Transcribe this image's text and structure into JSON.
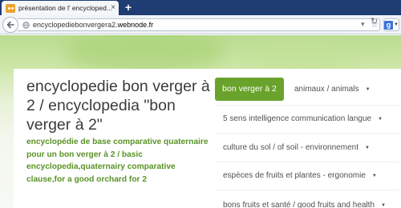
{
  "browser": {
    "tab_title": "présentation de l' encycloped...",
    "tab_close": "×",
    "new_tab": "+",
    "url_prefix": "encyclopediebonvergera2.",
    "url_domain": "webnode.fr",
    "search_engine_icon": "google-icon",
    "search_engine_letter": "g"
  },
  "site": {
    "title": "encyclopedie bon verger à 2 / encyclopedia \"bon verger à 2\"",
    "description": "encyclopédie de base comparative quaternaire pour un bon verger à 2 / basic encyclopedia,quaternairy comparative clause,for a good orchard for 2",
    "accent_color": "#6aa32b",
    "description_color": "#5a9226"
  },
  "nav": {
    "active": "bon verger à 2",
    "items": [
      "animaux / animals",
      "5 sens intelligence communication langue",
      "culture du sol / of soil - environnement",
      "espèces de fruits et plantes - ergonomie",
      "bons fruits et santé / good fruits and health"
    ]
  }
}
